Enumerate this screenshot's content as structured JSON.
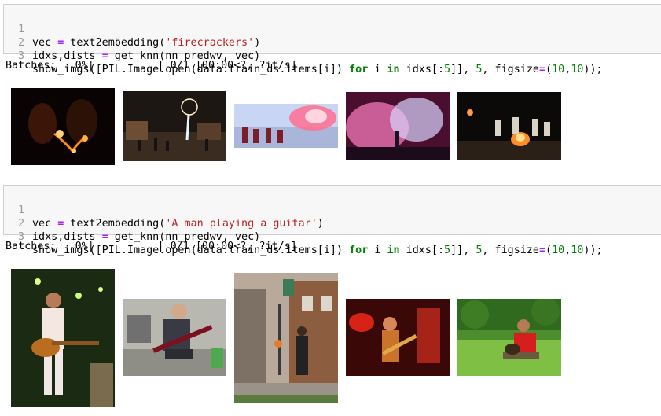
{
  "cells": [
    {
      "lines": [
        {
          "num": "1",
          "parts": [
            "vec ",
            "=",
            " text2embedding(",
            "'firecrackers'",
            ")"
          ]
        },
        {
          "num": "2",
          "parts": [
            "idxs,dists ",
            "=",
            " get_knn(nn_predwv, vec)"
          ]
        },
        {
          "num": "3",
          "parts": [
            "show_imgs([PIL.Image.open(data.train_ds.items[i]) ",
            "for",
            " i ",
            "in",
            " idxs[:",
            "5",
            "]], ",
            "5",
            ", figsize",
            "=",
            "(",
            "10",
            ",",
            "10",
            "));"
          ]
        }
      ],
      "output": "Batches:   0%|          | 0/1 [00:00<?, ?it/s]",
      "images": [
        "firecracker-sparkler-image",
        "firework-crowd-image",
        "flare-people-image",
        "stage-smoke-image",
        "campfire-night-image"
      ]
    },
    {
      "lines": [
        {
          "num": "1",
          "parts": [
            "vec ",
            "=",
            " text2embedding(",
            "'A man playing a guitar'",
            ")"
          ]
        },
        {
          "num": "2",
          "parts": [
            "idxs,dists ",
            "=",
            " get_knn(nn_predwv, vec)"
          ]
        },
        {
          "num": "3",
          "parts": [
            "show_imgs([PIL.Image.open(data.train_ds.items[i]) ",
            "for",
            " i ",
            "in",
            " idxs[:",
            "5",
            "]], ",
            "5",
            ", figsize",
            "=",
            "(",
            "10",
            ",",
            "10",
            "));"
          ]
        }
      ],
      "output": "Batches:   0%|          | 0/1 [00:00<?, ?it/s]",
      "images": [
        "guitarist-stage-image",
        "street-guitarist-image",
        "city-street-image",
        "red-light-guitarist-image",
        "park-guitarist-image"
      ]
    }
  ],
  "colors": {
    "cell_bg": "#f7f7f7",
    "cell_border": "#cfcfcf",
    "line_number": "#999999",
    "operator": "#aa22ff",
    "string": "#ba2121",
    "keyword": "#008000",
    "number": "#008000"
  }
}
